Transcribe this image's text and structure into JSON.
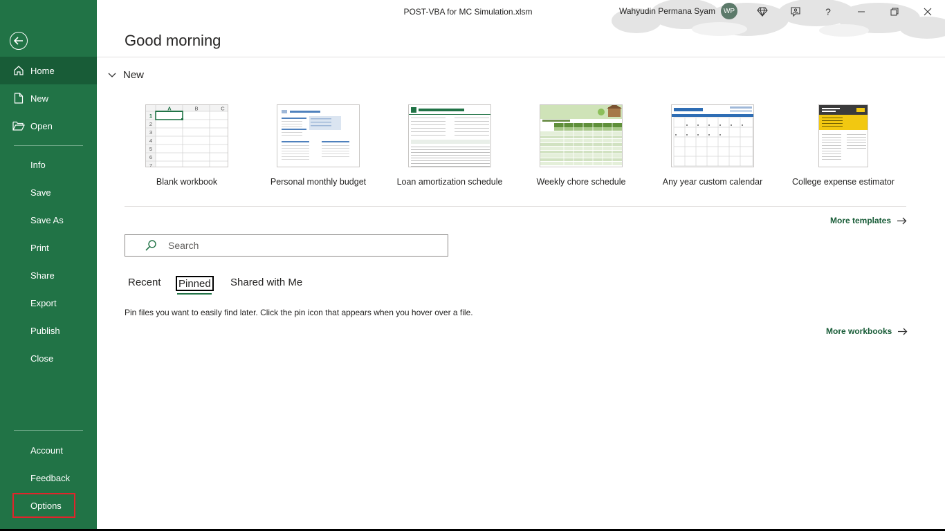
{
  "window": {
    "doc_title": "POST-VBA for MC Simulation.xlsm",
    "user_name": "Wahyudin Permana Syam",
    "user_initials": "WP",
    "icons": [
      "diamond-icon",
      "coauthor-icon",
      "help-icon",
      "minimize-icon",
      "restore-icon",
      "close-icon"
    ],
    "help_glyph": "?"
  },
  "sidebar": {
    "top_items": [
      {
        "label": "Home",
        "icon": "home-icon"
      },
      {
        "label": "New",
        "icon": "new-document-icon"
      },
      {
        "label": "Open",
        "icon": "folder-open-icon"
      }
    ],
    "middle_items": [
      "Info",
      "Save",
      "Save As",
      "Print",
      "Share",
      "Export",
      "Publish",
      "Close"
    ],
    "bottom_items": [
      "Account",
      "Feedback",
      "Options"
    ],
    "accent": "#217346",
    "active_bg": "#185c37",
    "highlight": "#e0242b"
  },
  "main": {
    "greeting": "Good morning",
    "new_section": "New",
    "templates": [
      {
        "name": "Blank workbook"
      },
      {
        "name": "Personal monthly budget"
      },
      {
        "name": "Loan amortization schedule"
      },
      {
        "name": "Weekly chore schedule"
      },
      {
        "name": "Any year custom calendar"
      },
      {
        "name": "College expense estimator"
      }
    ],
    "blank_cols": [
      "A",
      "B",
      "C"
    ],
    "blank_rows": [
      "1",
      "2",
      "3",
      "4",
      "5",
      "6",
      "7"
    ],
    "more_templates": "More templates",
    "search_placeholder": "Search",
    "tabs": [
      "Recent",
      "Pinned",
      "Shared with Me"
    ],
    "selected_tab": "Pinned",
    "pinned_hint": "Pin files you want to easily find later. Click the pin icon that appears when you hover over a file.",
    "more_workbooks": "More workbooks"
  }
}
